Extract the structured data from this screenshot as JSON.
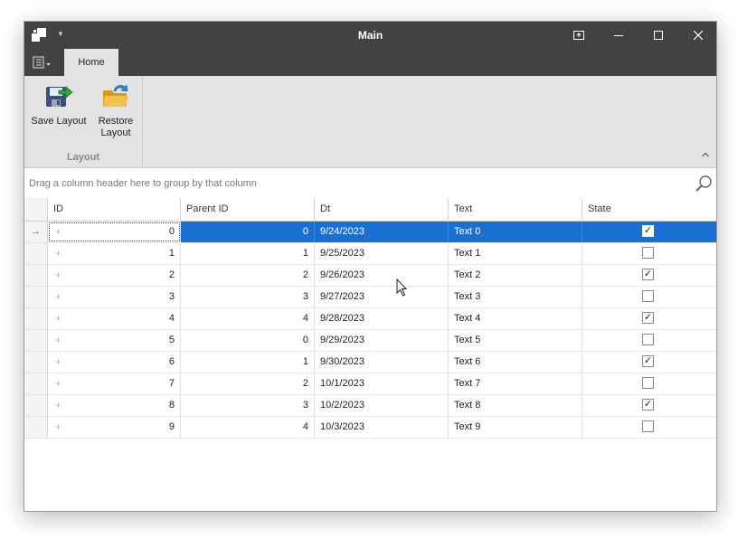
{
  "window": {
    "title": "Main",
    "tab_home": "Home"
  },
  "ribbon": {
    "save_layout": "Save Layout",
    "restore_layout_line1": "Restore",
    "restore_layout_line2": "Layout",
    "group_label": "Layout"
  },
  "grid": {
    "group_panel_hint": "Drag a column header here to group by that column",
    "columns": [
      "ID",
      "Parent ID",
      "Dt",
      "Text",
      "State"
    ],
    "selected_row": 0,
    "rows": [
      {
        "id": "0",
        "parent_id": "0",
        "dt": "9/24/2023",
        "text": "Text 0",
        "state": true
      },
      {
        "id": "1",
        "parent_id": "1",
        "dt": "9/25/2023",
        "text": "Text 1",
        "state": false
      },
      {
        "id": "2",
        "parent_id": "2",
        "dt": "9/26/2023",
        "text": "Text 2",
        "state": true
      },
      {
        "id": "3",
        "parent_id": "3",
        "dt": "9/27/2023",
        "text": "Text 3",
        "state": false
      },
      {
        "id": "4",
        "parent_id": "4",
        "dt": "9/28/2023",
        "text": "Text 4",
        "state": true
      },
      {
        "id": "5",
        "parent_id": "0",
        "dt": "9/29/2023",
        "text": "Text 5",
        "state": false
      },
      {
        "id": "6",
        "parent_id": "1",
        "dt": "9/30/2023",
        "text": "Text 6",
        "state": true
      },
      {
        "id": "7",
        "parent_id": "2",
        "dt": "10/1/2023",
        "text": "Text 7",
        "state": false
      },
      {
        "id": "8",
        "parent_id": "3",
        "dt": "10/2/2023",
        "text": "Text 8",
        "state": true
      },
      {
        "id": "9",
        "parent_id": "4",
        "dt": "10/3/2023",
        "text": "Text 9",
        "state": false
      }
    ]
  },
  "colors": {
    "titlebar": "#424242",
    "ribbon": "#e3e3e3",
    "selection": "#1a70d0"
  },
  "icons": {
    "app": "app-icon",
    "save": "save-layout-icon",
    "restore": "restore-layout-icon",
    "search": "search-icon",
    "row_indicator": "row-indicator-arrow-icon"
  }
}
